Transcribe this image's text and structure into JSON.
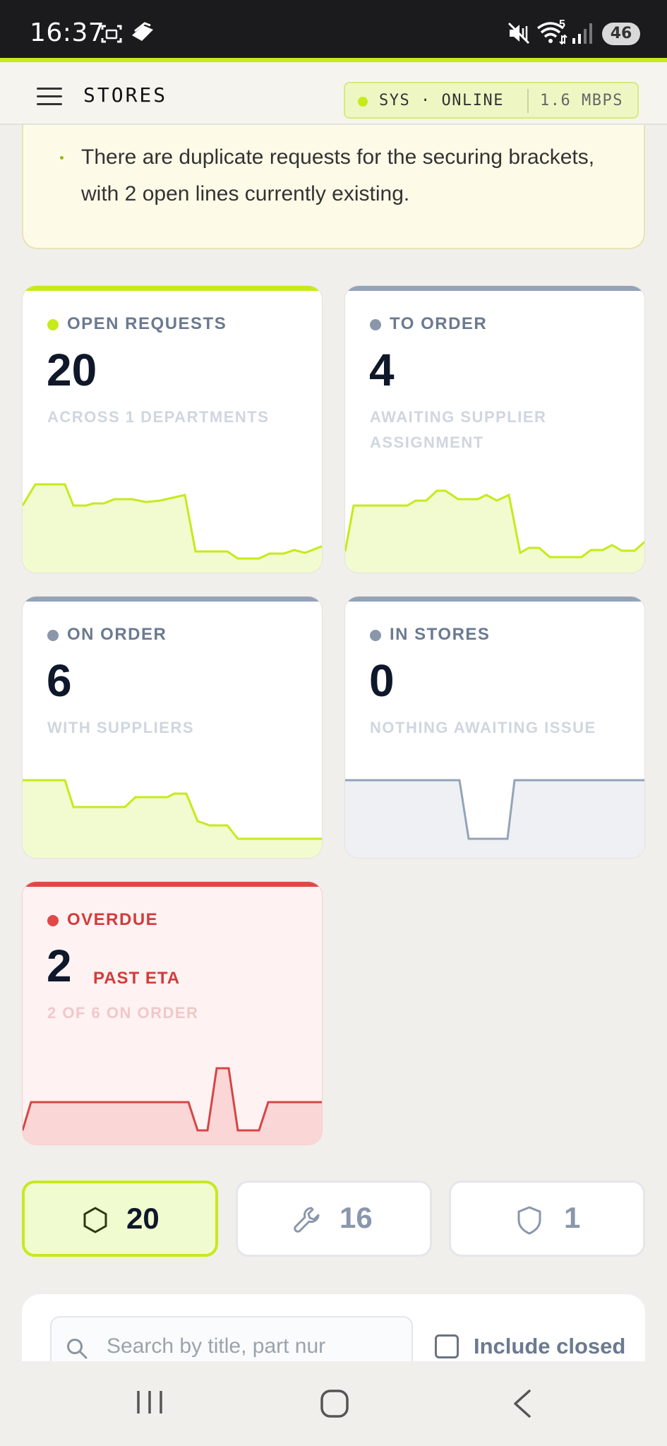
{
  "status_bar": {
    "time": "16:37",
    "network": "5",
    "battery": "46"
  },
  "header": {
    "title": "STORES",
    "status": "SYS · ONLINE",
    "rate": "1.6 MBPS"
  },
  "note": {
    "text": "There are duplicate requests for the securing brackets, with 2 open lines currently existing."
  },
  "cards": [
    {
      "label": "OPEN REQUESTS",
      "value": "20",
      "sub": "ACROSS 1 DEPARTMENTS",
      "accent": "#c6ea1a",
      "dot": "#c6ea1a"
    },
    {
      "label": "TO ORDER",
      "value": "4",
      "sub": "AWAITING SUPPLIER ASSIGNMENT",
      "accent": "#94a3b8",
      "dot": "#8a97ab"
    },
    {
      "label": "ON ORDER",
      "value": "6",
      "sub": "WITH SUPPLIERS",
      "accent": "#94a3b8",
      "dot": "#8a97ab"
    },
    {
      "label": "IN STORES",
      "value": "0",
      "sub": "NOTHING AWAITING ISSUE",
      "accent": "#94a3b8",
      "dot": "#8a97ab"
    },
    {
      "label": "OVERDUE",
      "value": "2",
      "extra": "PAST ETA",
      "sub": "2 OF 6 ON ORDER",
      "accent": "#e04848",
      "dot": "#e04848"
    }
  ],
  "tabs": [
    {
      "icon": "hexagon-icon",
      "count": "20",
      "active": true
    },
    {
      "icon": "wrench-icon",
      "count": "16",
      "active": false
    },
    {
      "icon": "shield-icon",
      "count": "1",
      "active": false
    }
  ],
  "search": {
    "placeholder": "Search by title, part nur",
    "value": ""
  },
  "filter": {
    "include_closed_label": "Include closed",
    "include_closed": false
  }
}
